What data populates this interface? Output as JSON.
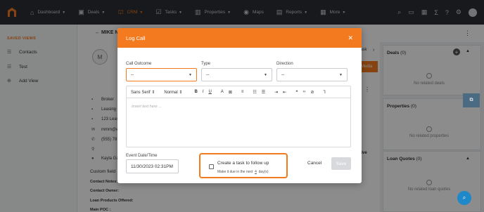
{
  "nav": {
    "items": [
      {
        "label": "Dashboard",
        "icon": "home-icon",
        "caret": true
      },
      {
        "label": "Deals",
        "icon": "deals-icon",
        "caret": true
      },
      {
        "label": "CRM",
        "icon": "crm-icon",
        "caret": true,
        "active": true
      },
      {
        "label": "Tasks",
        "icon": "tasks-icon",
        "caret": true
      },
      {
        "label": "Properties",
        "icon": "properties-icon",
        "caret": true
      },
      {
        "label": "Maps",
        "icon": "maps-icon",
        "caret": false
      },
      {
        "label": "Reports",
        "icon": "reports-icon",
        "caret": true
      },
      {
        "label": "More",
        "icon": "more-icon",
        "caret": true
      }
    ],
    "accent_color": "#f47a20"
  },
  "sidebar": {
    "section_title": "SAVED VIEWS",
    "items": [
      {
        "label": "Contacts",
        "icon": "list-icon"
      },
      {
        "label": "Test",
        "icon": "list-icon"
      },
      {
        "label": "Add View",
        "icon": "plus-circle-icon"
      }
    ]
  },
  "contact": {
    "name_fragment": "MIKE N",
    "avatar_letter": "M",
    "details": [
      {
        "icon": "briefcase-icon",
        "text": "Broker"
      },
      {
        "icon": "building-icon",
        "text": "Leasing M"
      },
      {
        "icon": "address-icon",
        "text": "123 Leas"
      },
      {
        "icon": "email-icon",
        "text": "mmm@er"
      },
      {
        "icon": "phone-icon",
        "text": "(555) 78"
      },
      {
        "icon": "location-icon",
        "text": ""
      },
      {
        "icon": "user-icon",
        "text": "Kayla Ga"
      }
    ],
    "custom_fields_label": "Custom field",
    "fields": [
      "Contact Notes:",
      "Contact Owner:",
      "Loan Products Offered:",
      "Main POC :"
    ]
  },
  "background_fragments": {
    "tab_fragment": "ask",
    "orange_tab": "Media",
    "active_fragment": "ctive"
  },
  "right_panel": {
    "cards": [
      {
        "title": "Deals",
        "count": "(0)",
        "empty": "No related deals"
      },
      {
        "title": "Properties",
        "count": "(0)",
        "empty": "No related properties"
      },
      {
        "title": "Loan Quotes",
        "count": "(0)",
        "empty": "No related loan quotes"
      }
    ]
  },
  "modal": {
    "title": "Log Call",
    "call_outcome_label": "Call Outcome",
    "call_outcome_value": "--",
    "type_label": "Type",
    "type_value": "--",
    "direction_label": "Direction",
    "direction_value": "--",
    "toolbar": {
      "font": "Sans Serif",
      "size": "Normal",
      "bold": "B",
      "italic": "I",
      "underline": "U"
    },
    "editor_placeholder": "Insert text here ...",
    "event_label": "Event Date/Time",
    "event_value": "11/30/2023  02:31PM",
    "followup_title": "Create a task to follow up",
    "followup_sub_prefix": "Make it due in the next",
    "followup_days": "4",
    "followup_sub_suffix": "day(s)",
    "cancel_label": "Cancel",
    "save_label": "Save"
  }
}
